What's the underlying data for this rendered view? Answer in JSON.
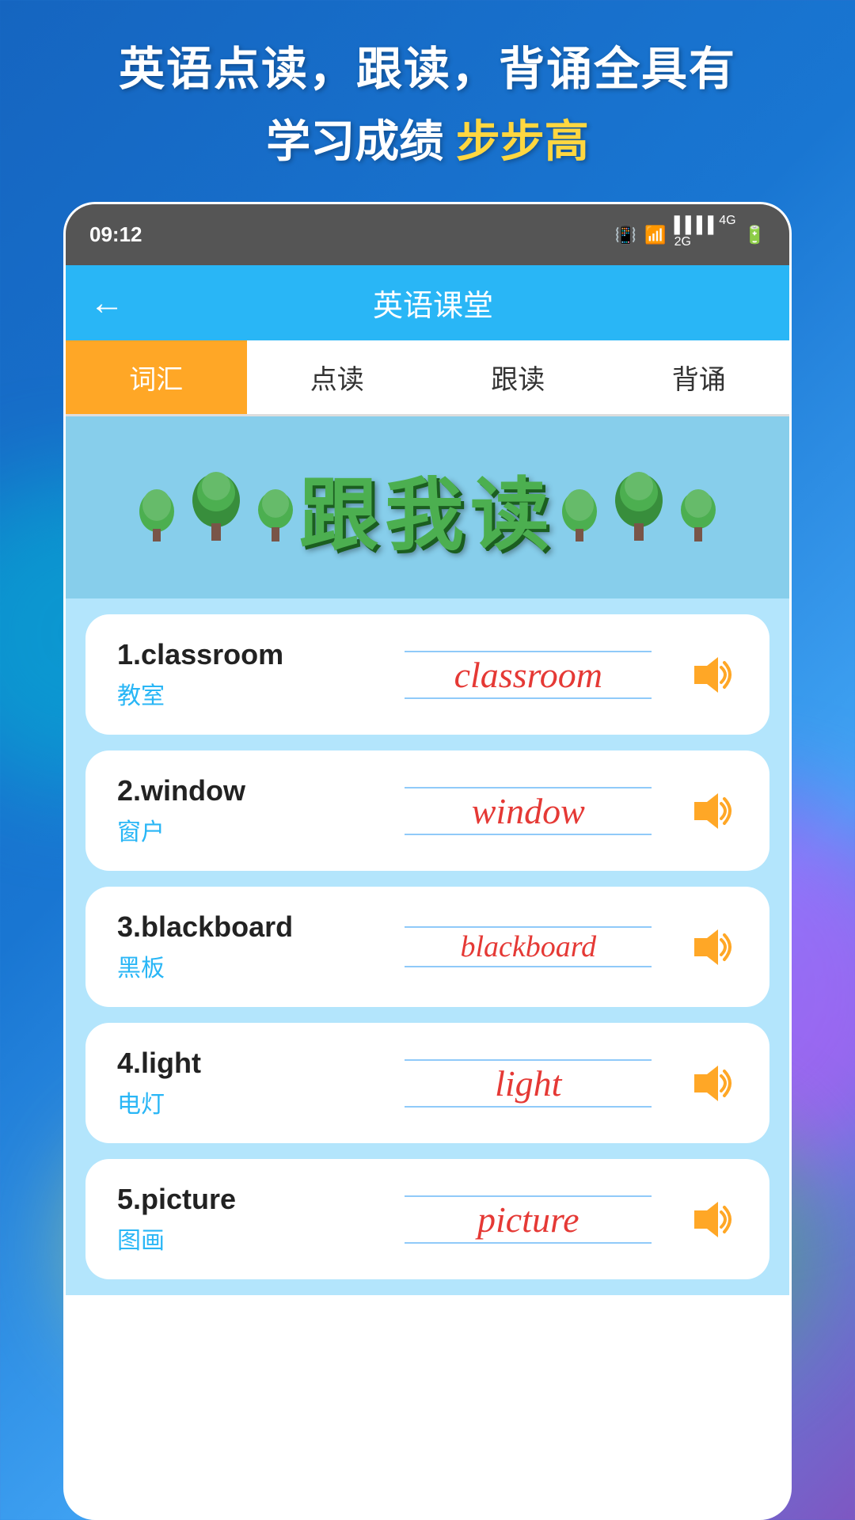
{
  "background": {
    "top_line1": "英语点读，跟读，背诵全具有",
    "top_line2_prefix": "学习成绩",
    "top_line2_highlight": "步步高"
  },
  "status_bar": {
    "time": "09:12",
    "icons": "📳 📶 4G 🔋"
  },
  "header": {
    "back_label": "←",
    "title": "英语课堂"
  },
  "tabs": [
    {
      "id": "vocab",
      "label": "词汇",
      "active": true
    },
    {
      "id": "read",
      "label": "点读",
      "active": false
    },
    {
      "id": "follow",
      "label": "跟读",
      "active": false
    },
    {
      "id": "recite",
      "label": "背诵",
      "active": false
    }
  ],
  "banner": {
    "text": "跟我读"
  },
  "vocab_items": [
    {
      "index": 1,
      "english": "classroom",
      "chinese": "教室",
      "display_word": "classroom"
    },
    {
      "index": 2,
      "english": "window",
      "chinese": "窗户",
      "display_word": "window"
    },
    {
      "index": 3,
      "english": "blackboard",
      "chinese": "黑板",
      "display_word": "blackboard"
    },
    {
      "index": 4,
      "english": "light",
      "chinese": "电灯",
      "display_word": "light"
    },
    {
      "index": 5,
      "english": "picture",
      "chinese": "图画",
      "display_word": "picture"
    }
  ]
}
